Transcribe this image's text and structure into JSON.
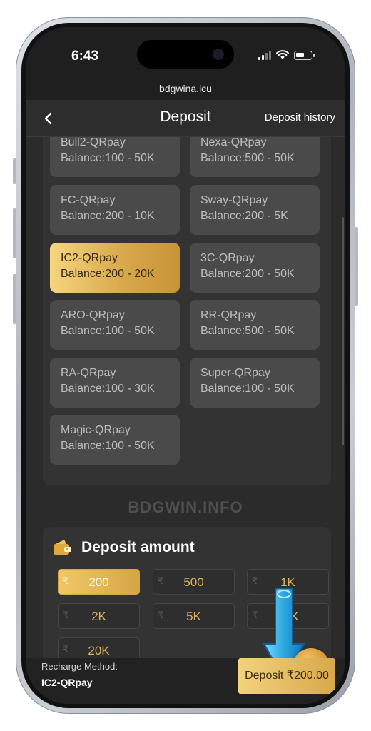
{
  "status_bar": {
    "time": "6:43"
  },
  "browser": {
    "url": "bdgwina.icu"
  },
  "nav": {
    "title": "Deposit",
    "history_label": "Deposit history"
  },
  "channels": [
    {
      "name": "Bull2-QRpay",
      "balance": "Balance:100 - 50K",
      "selected": false
    },
    {
      "name": "Nexa-QRpay",
      "balance": "Balance:500 - 50K",
      "selected": false
    },
    {
      "name": "FC-QRpay",
      "balance": "Balance:200 - 10K",
      "selected": false
    },
    {
      "name": "Sway-QRpay",
      "balance": "Balance:200 - 5K",
      "selected": false
    },
    {
      "name": "IC2-QRpay",
      "balance": "Balance:200 - 20K",
      "selected": true
    },
    {
      "name": "3C-QRpay",
      "balance": "Balance:200 - 50K",
      "selected": false
    },
    {
      "name": "ARO-QRpay",
      "balance": "Balance:100 - 50K",
      "selected": false
    },
    {
      "name": "RR-QRpay",
      "balance": "Balance:500 - 50K",
      "selected": false
    },
    {
      "name": "RA-QRpay",
      "balance": "Balance:100 - 30K",
      "selected": false
    },
    {
      "name": "Super-QRpay",
      "balance": "Balance:100 - 50K",
      "selected": false
    },
    {
      "name": "Magic-QRpay",
      "balance": "Balance:100 - 50K",
      "selected": false
    }
  ],
  "watermark": "BDGWIN.INFO",
  "deposit_amount": {
    "title": "Deposit amount",
    "currency_symbol": "₹",
    "options": [
      {
        "value": "200",
        "selected": true
      },
      {
        "value": "500",
        "selected": false
      },
      {
        "value": "1K",
        "selected": false
      },
      {
        "value": "2K",
        "selected": false
      },
      {
        "value": "5K",
        "selected": false
      },
      {
        "value": "10K",
        "selected": false
      },
      {
        "value": "20K",
        "selected": false
      }
    ]
  },
  "footer": {
    "method_label": "Recharge Method:",
    "method_value": "IC2-QRpay",
    "deposit_button": "Deposit ₹200.00"
  },
  "colors": {
    "gold_accent": "#d9a94d",
    "background": "#2b2b2b",
    "panel": "#333333",
    "arrow": "#2aa7e0"
  }
}
